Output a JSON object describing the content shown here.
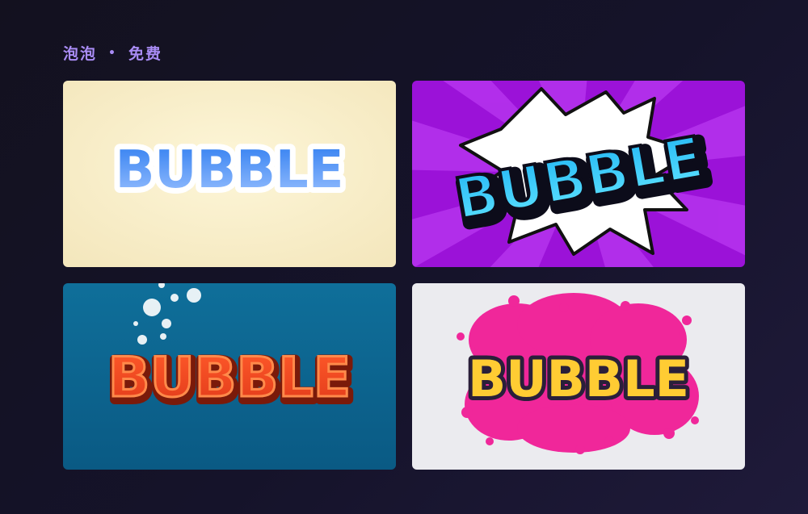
{
  "section": {
    "title": "泡泡",
    "separator": "•",
    "badge": "免费"
  },
  "cards": [
    {
      "text": "BUBBLE",
      "style": "glossy-blue-on-cream"
    },
    {
      "text": "BUBBLE",
      "style": "comic-cyan-on-purple-burst"
    },
    {
      "text": "BUBBLE",
      "style": "red-scales-underwater"
    },
    {
      "text": "BUBBLE",
      "style": "yellow-on-pink-splash"
    }
  ],
  "colors": {
    "background": "#15132a",
    "accent": "#a98cf5"
  }
}
